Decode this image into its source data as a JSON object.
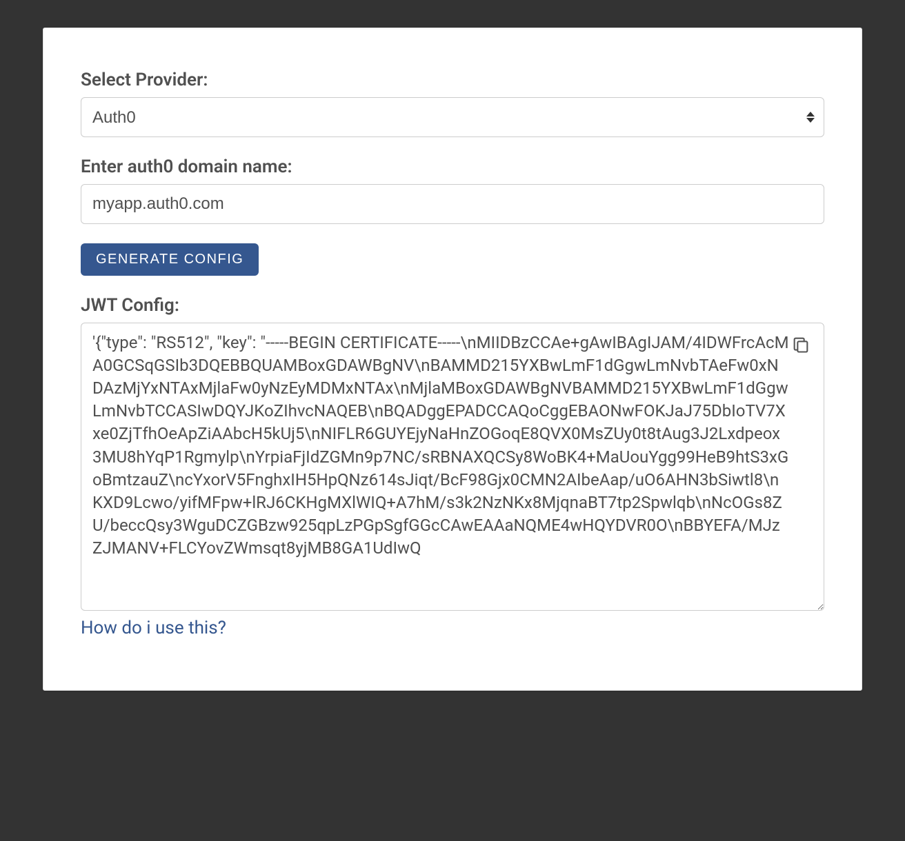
{
  "form": {
    "provider": {
      "label": "Select Provider:",
      "value": "Auth0"
    },
    "domain": {
      "label": "Enter auth0 domain name:",
      "value": "myapp.auth0.com"
    },
    "button": {
      "label": "Generate Config"
    },
    "config": {
      "label": "JWT Config:",
      "value": "'{\"type\": \"RS512\", \"key\": \"-----BEGIN CERTIFICATE-----\\nMIIDBzCCAe+gAwIBAgIJAM/4IDWFrcAcMA0GCSqGSIb3DQEBBQUAMBoxGDAWBgNV\\nBAMMD215YXBwLmF1dGgwLmNvbTAeFw0xNDAzMjYxNTAxMjlaFw0yNzEyMDMxNTAx\\nMjlaMBoxGDAWBgNVBAMMD215YXBwLmF1dGgwLmNvbTCCASIwDQYJKoZIhvcNAQEB\\nBQADggEPADCCAQoCggEBAONwFOKJaJ75DbIoTV7Xxe0ZjTfhOeApZiAAbcH5kUj5\\nNIFLR6GUYEjyNaHnZOGoqE8QVX0MsZUy0t8tAug3J2Lxdpeox3MU8hYqP1Rgmylp\\nYrpiaFjIdZGMn9p7NC/sRBNAXQCSy8WoBK4+MaUouYgg99HeB9htS3xGoBmtzauZ\\ncYxorV5FnghxIH5HpQNz614sJiqt/BcF98Gjx0CMN2AIbeAap/uO6AHN3bSiwtl8\\nKXD9Lcwo/yifMFpw+lRJ6CKHgMXlWIQ+A7hM/s3k2NzNKx8MjqnaBT7tp2Spwlqb\\nNcOGs8ZU/beccQsy3WguDCZGBzw925qpLzPGpSgfGGcCAwEAAaNQME4wHQYDVR0O\\nBBYEFA/MJzZJMANV+FLCYovZWmsqt8yjMB8GA1UdIwQ"
    },
    "help": {
      "label": "How do i use this?"
    }
  }
}
